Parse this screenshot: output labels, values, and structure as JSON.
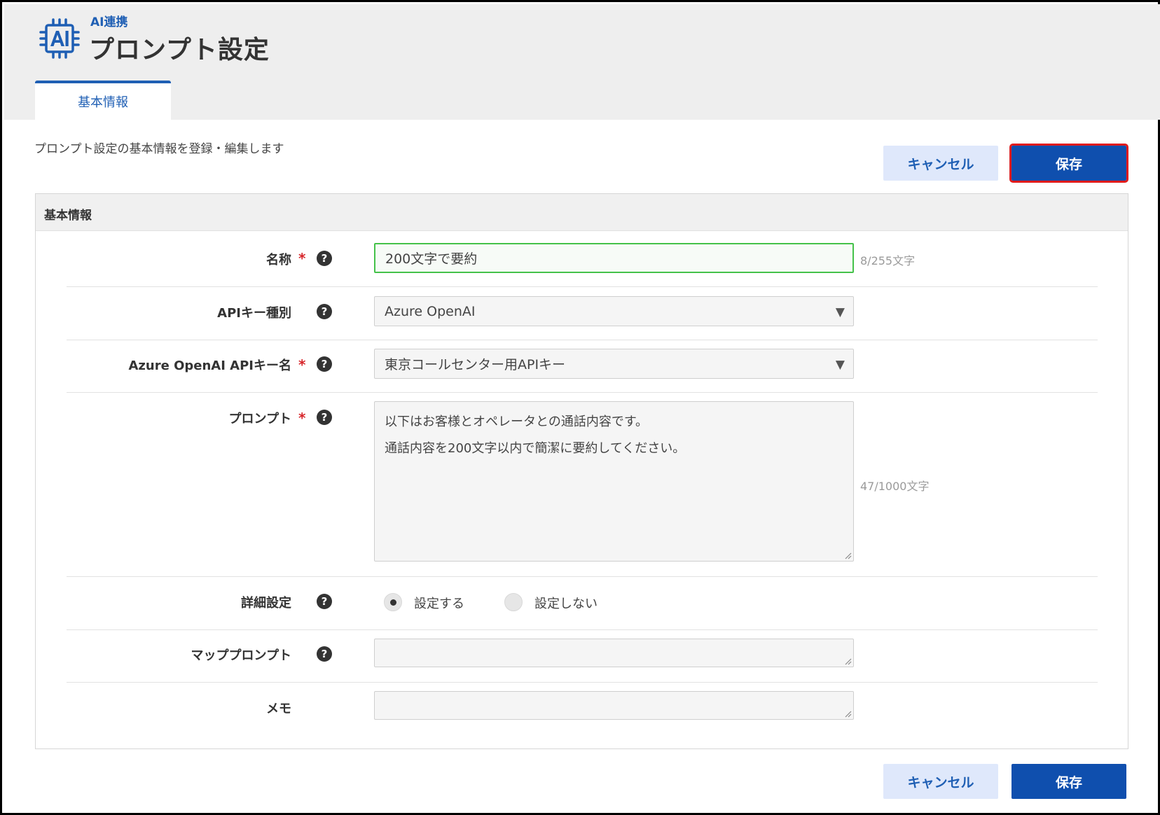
{
  "header": {
    "module_name": "AI連携",
    "page_title": "プロンプト設定",
    "icon": "ai-chip-icon",
    "tabs": [
      {
        "label": "基本情報",
        "active": true
      }
    ]
  },
  "description": "プロンプト設定の基本情報を登録・編集します",
  "actions": {
    "cancel_label": "キャンセル",
    "save_label": "保存"
  },
  "panel": {
    "title": "基本情報",
    "fields": {
      "name": {
        "label": "名称",
        "required": true,
        "value": "200文字で要約",
        "counter": "8/255文字"
      },
      "api_key_type": {
        "label": "APIキー種別",
        "required": false,
        "value": "Azure OpenAI"
      },
      "api_key_name": {
        "label": "Azure OpenAI APIキー名",
        "required": true,
        "value": "東京コールセンター用APIキー"
      },
      "prompt": {
        "label": "プロンプト",
        "required": true,
        "lines": [
          "以下はお客様とオペレータとの通話内容です。",
          "通話内容を200文字以内で簡潔に要約してください。"
        ],
        "counter": "47/1000文字"
      },
      "detail_settings": {
        "label": "詳細設定",
        "options": [
          {
            "label": "設定する",
            "checked": true
          },
          {
            "label": "設定しない",
            "checked": false
          }
        ]
      },
      "map_prompt": {
        "label": "マッププロンプト",
        "value": ""
      },
      "memo": {
        "label": "メモ",
        "value": ""
      }
    },
    "required_mark": "*",
    "help_mark": "?"
  },
  "colors": {
    "accent": "#1f5fb4",
    "save_button": "#0f4fae",
    "cancel_button_bg": "#dfe8fb",
    "required": "#d7262b",
    "focus_border": "#45c24a",
    "highlight_outline": "#e01b1b"
  }
}
